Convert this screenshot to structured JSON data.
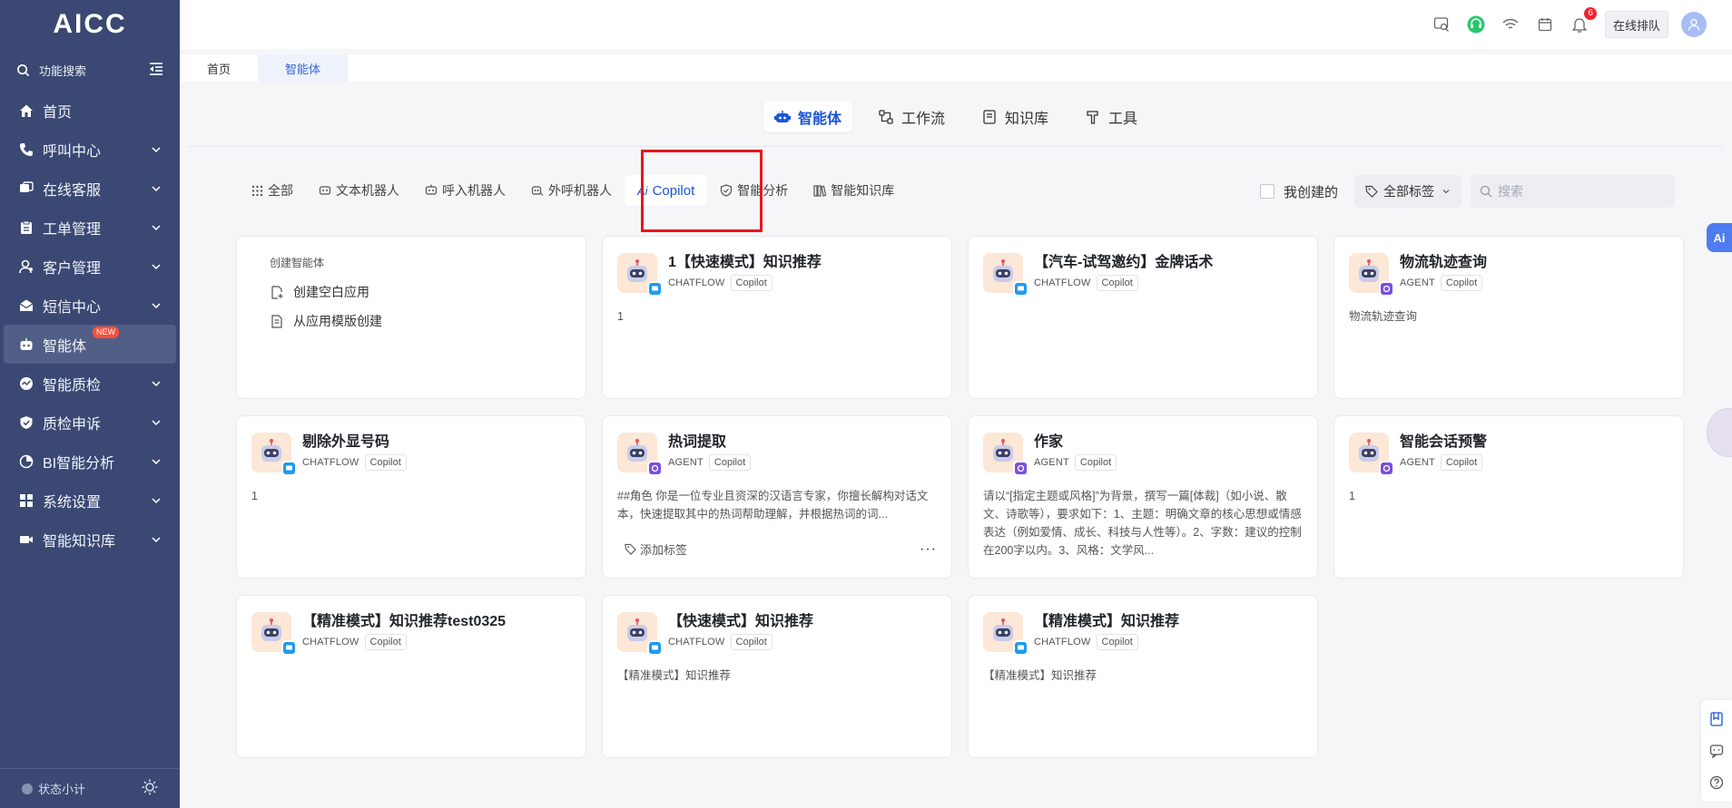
{
  "app": {
    "logo": "AICC"
  },
  "sidebar": {
    "search_label": "功能搜索",
    "items": [
      {
        "label": "首页",
        "icon": "home-icon",
        "has_children": false
      },
      {
        "label": "呼叫中心",
        "icon": "phone-icon",
        "has_children": true
      },
      {
        "label": "在线客服",
        "icon": "chat-icon",
        "has_children": true
      },
      {
        "label": "工单管理",
        "icon": "clipboard-icon",
        "has_children": true
      },
      {
        "label": "客户管理",
        "icon": "user-icon",
        "has_children": true
      },
      {
        "label": "短信中心",
        "icon": "mail-icon",
        "has_children": true
      },
      {
        "label": "智能体",
        "icon": "robot-icon",
        "has_children": false,
        "active": true,
        "badge": "NEW"
      },
      {
        "label": "智能质检",
        "icon": "quality-icon",
        "has_children": true
      },
      {
        "label": "质检申诉",
        "icon": "shield-icon",
        "has_children": true
      },
      {
        "label": "BI智能分析",
        "icon": "pie-chart-icon",
        "has_children": true
      },
      {
        "label": "系统设置",
        "icon": "grid-icon",
        "has_children": true
      },
      {
        "label": "智能知识库",
        "icon": "video-icon",
        "has_children": true
      }
    ],
    "footer_label": "状态小计"
  },
  "header": {
    "notification_count": "6",
    "queue_button": "在线排队"
  },
  "page_tabs": [
    {
      "label": "首页",
      "active": false
    },
    {
      "label": "智能体",
      "active": true
    }
  ],
  "top_tabs": [
    {
      "label": "智能体",
      "active": true
    },
    {
      "label": "工作流",
      "active": false
    },
    {
      "label": "知识库",
      "active": false
    },
    {
      "label": "工具",
      "active": false
    }
  ],
  "filter_tabs": [
    {
      "label": "全部",
      "active": false
    },
    {
      "label": "文本机器人",
      "active": false
    },
    {
      "label": "呼入机器人",
      "active": false
    },
    {
      "label": "外呼机器人",
      "active": false
    },
    {
      "label": "Copilot",
      "active": true
    },
    {
      "label": "智能分析",
      "active": false
    },
    {
      "label": "智能知识库",
      "active": false
    }
  ],
  "filters": {
    "mine_label": "我创建的",
    "tag_select": "全部标签",
    "search_placeholder": "搜索"
  },
  "create_card": {
    "title": "创建智能体",
    "blank_label": "创建空白应用",
    "template_label": "从应用模版创建"
  },
  "agents": [
    {
      "name": "1【快速模式】知识推荐",
      "mode": "CHATFLOW",
      "tag": "Copilot",
      "desc": "1"
    },
    {
      "name": "【汽车-试驾邀约】金牌话术",
      "mode": "CHATFLOW",
      "tag": "Copilot",
      "desc": ""
    },
    {
      "name": "物流轨迹查询",
      "mode": "AGENT",
      "tag": "Copilot",
      "desc": "物流轨迹查询"
    },
    {
      "name": "剔除外显号码",
      "mode": "CHATFLOW",
      "tag": "Copilot",
      "desc": "1"
    },
    {
      "name": "热词提取",
      "mode": "AGENT",
      "tag": "Copilot",
      "desc": "##角色 你是一位专业且资深的汉语言专家，你擅长解构对话文本，快速提取其中的热词帮助理解，并根据热词的词...",
      "add_tag_label": "添加标签",
      "more": "···"
    },
    {
      "name": "作家",
      "mode": "AGENT",
      "tag": "Copilot",
      "desc": "请以“[指定主题或风格]”为背景，撰写一篇[体裁]（如小说、散文、诗歌等），要求如下：1、主题：明确文章的核心思想或情感表达（例如爱情、成长、科技与人性等）。2、字数：建议的控制在200字以内。3、风格：文学风..."
    },
    {
      "name": "智能会话预警",
      "mode": "AGENT",
      "tag": "Copilot",
      "desc": "1"
    },
    {
      "name": "【精准模式】知识推荐test0325",
      "mode": "CHATFLOW",
      "tag": "Copilot",
      "desc": ""
    },
    {
      "name": "【快速模式】知识推荐",
      "mode": "CHATFLOW",
      "tag": "Copilot",
      "desc": "【精准模式】知识推荐"
    },
    {
      "name": "【精准模式】知识推荐",
      "mode": "CHATFLOW",
      "tag": "Copilot",
      "desc": "【精准模式】知识推荐"
    }
  ],
  "floating": {
    "ai_label": "Ai"
  },
  "colors": {
    "sidebar_bg": "#3a4873",
    "accent": "#1b55d6",
    "highlight": "#e8161d",
    "chatflow_badge": "#1d9bf0",
    "agent_badge": "#7b4fe0"
  }
}
